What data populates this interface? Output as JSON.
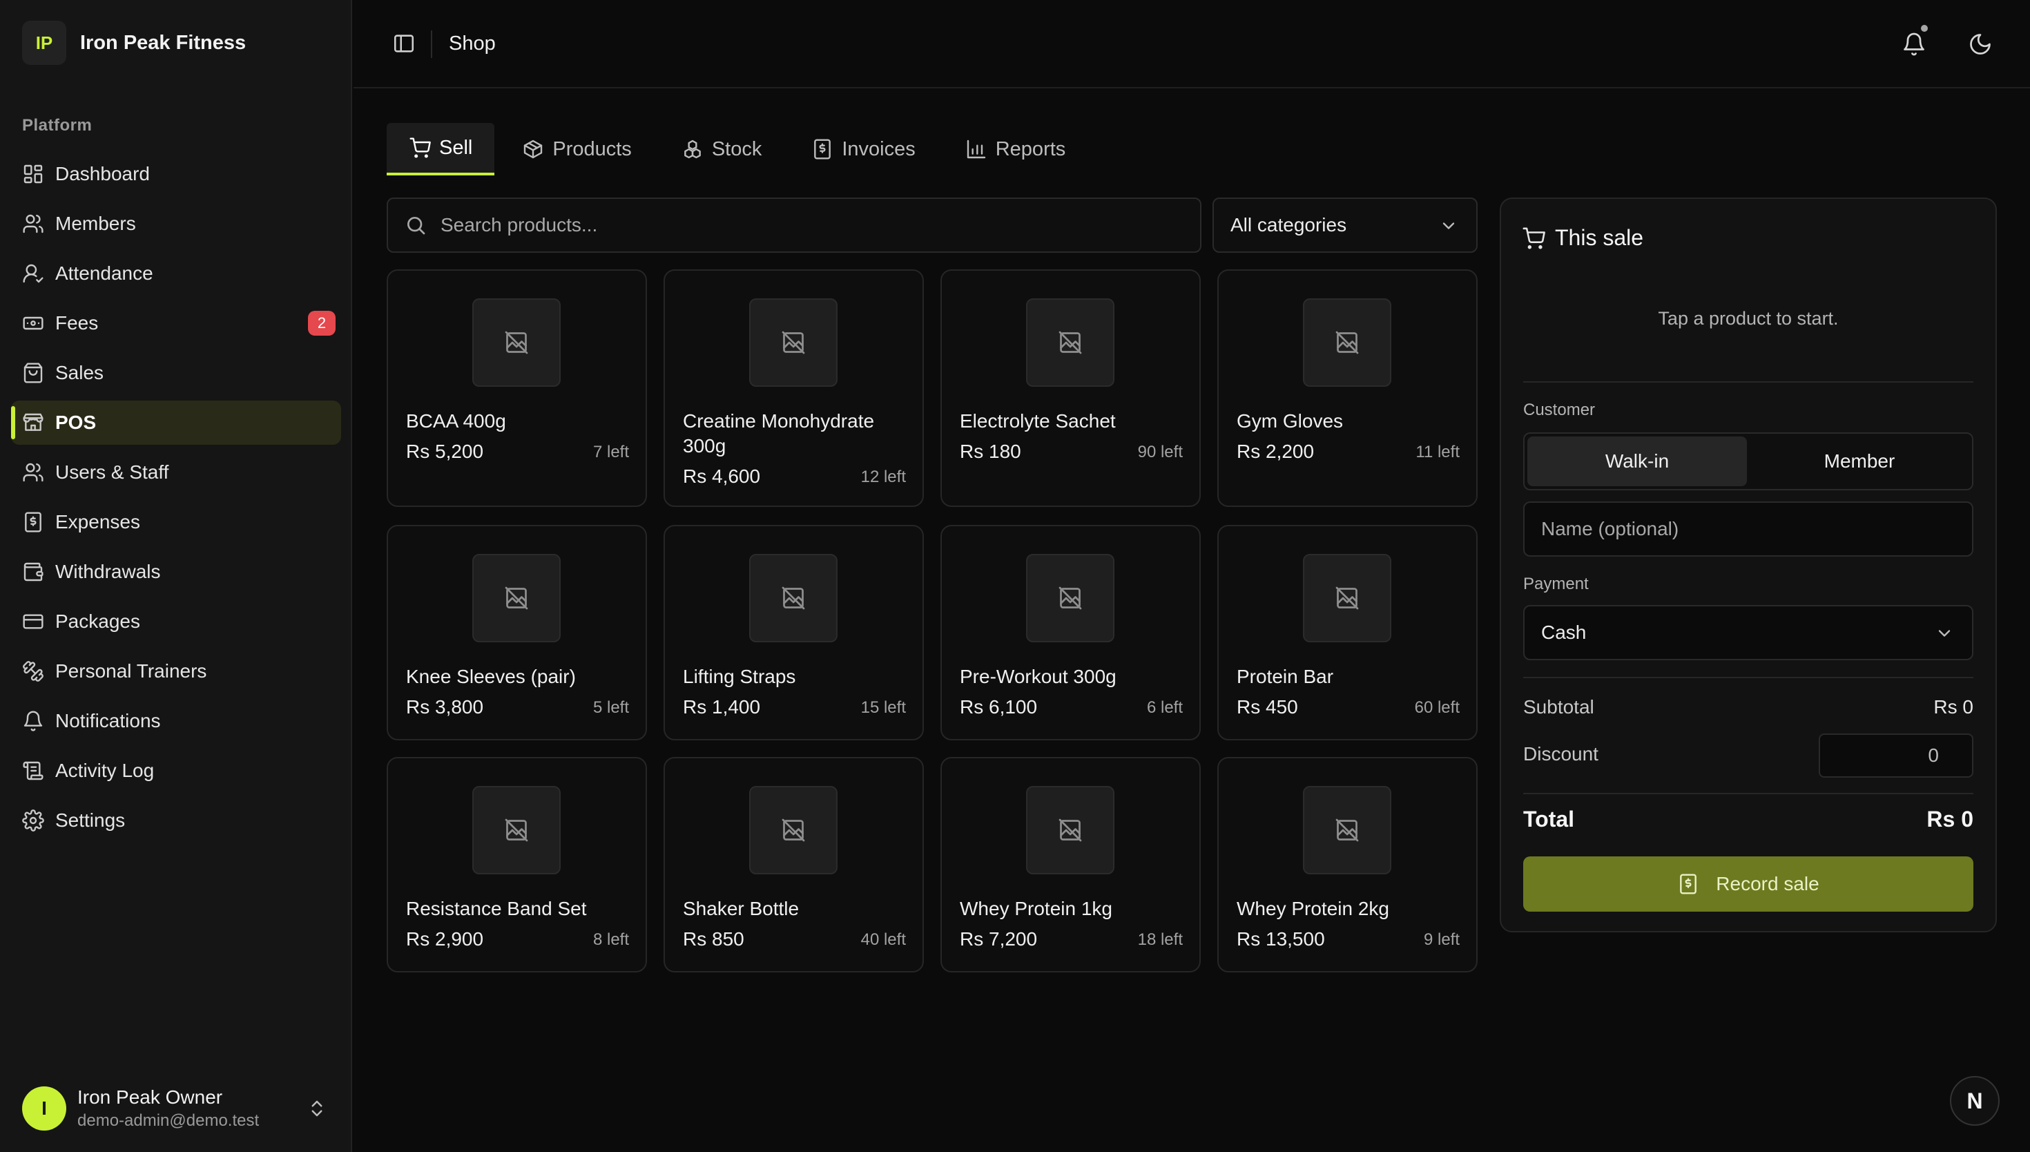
{
  "brand": {
    "logo_text": "IP",
    "name": "Iron Peak Fitness"
  },
  "sidebar": {
    "group_label": "Platform",
    "items": [
      {
        "label": "Dashboard",
        "icon": "dashboard-icon"
      },
      {
        "label": "Members",
        "icon": "users-icon"
      },
      {
        "label": "Attendance",
        "icon": "user-check-icon"
      },
      {
        "label": "Fees",
        "icon": "banknote-icon",
        "badge": "2"
      },
      {
        "label": "Sales",
        "icon": "shopping-bag-icon"
      },
      {
        "label": "POS",
        "icon": "store-icon",
        "active": true
      },
      {
        "label": "Users & Staff",
        "icon": "users-icon"
      },
      {
        "label": "Expenses",
        "icon": "receipt-icon"
      },
      {
        "label": "Withdrawals",
        "icon": "wallet-icon"
      },
      {
        "label": "Packages",
        "icon": "credit-card-icon"
      },
      {
        "label": "Personal Trainers",
        "icon": "dumbbell-icon"
      },
      {
        "label": "Notifications",
        "icon": "bell-icon"
      },
      {
        "label": "Activity Log",
        "icon": "logs-icon"
      },
      {
        "label": "Settings",
        "icon": "gear-icon"
      }
    ],
    "user": {
      "initial": "I",
      "name": "Iron Peak Owner",
      "email": "demo-admin@demo.test"
    }
  },
  "header": {
    "title": "Shop"
  },
  "tabs": [
    {
      "label": "Sell",
      "icon": "cart-icon",
      "active": true
    },
    {
      "label": "Products",
      "icon": "package-icon"
    },
    {
      "label": "Stock",
      "icon": "boxes-icon"
    },
    {
      "label": "Invoices",
      "icon": "receipt-icon"
    },
    {
      "label": "Reports",
      "icon": "bar-chart-icon"
    }
  ],
  "search": {
    "placeholder": "Search products..."
  },
  "category_filter": {
    "selected": "All categories"
  },
  "products": [
    {
      "name": "BCAA 400g",
      "price": "Rs 5,200",
      "stock": "7 left"
    },
    {
      "name": "Creatine Monohydrate 300g",
      "price": "Rs 4,600",
      "stock": "12 left"
    },
    {
      "name": "Electrolyte Sachet",
      "price": "Rs 180",
      "stock": "90 left"
    },
    {
      "name": "Gym Gloves",
      "price": "Rs 2,200",
      "stock": "11 left"
    },
    {
      "name": "Knee Sleeves (pair)",
      "price": "Rs 3,800",
      "stock": "5 left"
    },
    {
      "name": "Lifting Straps",
      "price": "Rs 1,400",
      "stock": "15 left"
    },
    {
      "name": "Pre-Workout 300g",
      "price": "Rs 6,100",
      "stock": "6 left"
    },
    {
      "name": "Protein Bar",
      "price": "Rs 450",
      "stock": "60 left"
    },
    {
      "name": "Resistance Band Set",
      "price": "Rs 2,900",
      "stock": "8 left"
    },
    {
      "name": "Shaker Bottle",
      "price": "Rs 850",
      "stock": "40 left"
    },
    {
      "name": "Whey Protein 1kg",
      "price": "Rs 7,200",
      "stock": "18 left"
    },
    {
      "name": "Whey Protein 2kg",
      "price": "Rs 13,500",
      "stock": "9 left"
    }
  ],
  "sale": {
    "title": "This sale",
    "empty_text": "Tap a product to start.",
    "customer_label": "Customer",
    "customer_options": [
      "Walk-in",
      "Member"
    ],
    "name_placeholder": "Name (optional)",
    "payment_label": "Payment",
    "payment_selected": "Cash",
    "subtotal_label": "Subtotal",
    "subtotal_value": "Rs 0",
    "discount_label": "Discount",
    "discount_value": "0",
    "total_label": "Total",
    "total_value": "Rs 0",
    "record_label": "Record sale"
  },
  "floating": {
    "label": "N"
  },
  "colors": {
    "accent": "#c8f135",
    "button": "#6d7a1f",
    "badge": "#e5484d"
  }
}
